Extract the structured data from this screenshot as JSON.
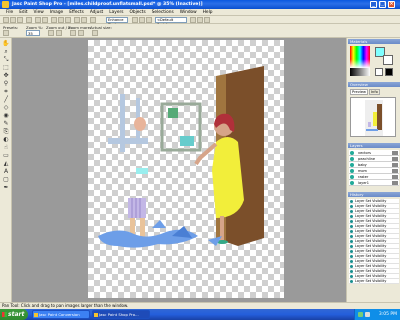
{
  "window": {
    "title": "Jasc Paint Shop Pro - [miles.childproof.unflatsmall.psd* @ 35% (Inactive)]"
  },
  "menu": [
    "File",
    "Edit",
    "View",
    "Image",
    "Effects",
    "Adjust",
    "Layers",
    "Objects",
    "Selections",
    "Window",
    "Help"
  ],
  "tool_options": {
    "presets_label": "Presets:",
    "zoom_label": "Zoom %:",
    "zoom_value": "35",
    "zoom_more_label": "Zoom out / In:",
    "zoom_more2_label": "Zoom more:",
    "actual_size_label": "Actual size:",
    "enhance_label": "Enhance Photo",
    "script_value": "<Default Script>"
  },
  "palettes": {
    "materials_title": "Materials",
    "overview_title": "Overview",
    "overview_tabs": [
      "Preview",
      "Info"
    ],
    "layers_title": "Layers",
    "history_title": "History"
  },
  "layers": [
    {
      "name": "vectors"
    },
    {
      "name": "peachline"
    },
    {
      "name": "baby"
    },
    {
      "name": "mom"
    },
    {
      "name": "raster"
    },
    {
      "name": "layer1"
    }
  ],
  "history": [
    "Layer Set Visibility",
    "Layer Set Visibility",
    "Layer Set Visibility",
    "Layer Set Visibility",
    "Layer Set Visibility",
    "Layer Set Visibility",
    "Layer Set Visibility",
    "Layer Set Visibility",
    "Layer Set Visibility",
    "Layer Set Visibility",
    "Layer Set Visibility",
    "Layer Set Visibility",
    "Layer Set Visibility",
    "Layer Set Visibility",
    "Layer Set Visibility",
    "Layer Set Visibility",
    "Layer Set Visibility"
  ],
  "status": {
    "text": "Pan Tool: Click and drag to pan images larger than the window."
  },
  "taskbar": {
    "start_label": "start",
    "items": [
      {
        "label": "Jasc Paint Conversion"
      },
      {
        "label": "Jasc Paint Shop Pro..."
      }
    ],
    "clock": "3:05 PM"
  },
  "colors": {
    "foreground_swatch": "#7fffff",
    "background_swatch": "#ffffff",
    "titlebar": "#0a58e0",
    "taskbar": "#245edb"
  }
}
